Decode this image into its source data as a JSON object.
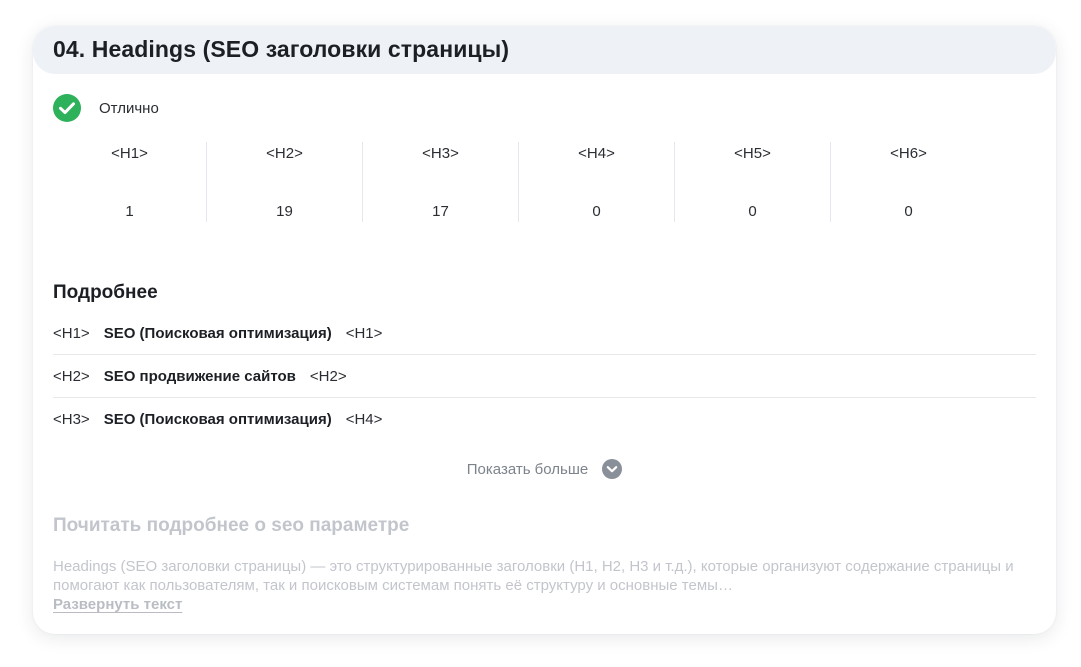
{
  "section": {
    "title": "04. Headings (SEO заголовки страницы)",
    "status": {
      "label": "Отлично",
      "state": "success",
      "color": "#2db15b"
    }
  },
  "headings_summary": [
    {
      "tag": "<H1>",
      "count": "1"
    },
    {
      "tag": "<H2>",
      "count": "19"
    },
    {
      "tag": "<H3>",
      "count": "17"
    },
    {
      "tag": "<H4>",
      "count": "0"
    },
    {
      "tag": "<H5>",
      "count": "0"
    },
    {
      "tag": "<H6>",
      "count": "0"
    }
  ],
  "details": {
    "title": "Подробнее",
    "rows": [
      {
        "open": "<H1>",
        "text": "SEO (Поисковая оптимизация)",
        "close": "<H1>"
      },
      {
        "open": "<H2>",
        "text": "SEO продвижение сайтов",
        "close": "<H2>"
      },
      {
        "open": "<H3>",
        "text": "SEO (Поисковая оптимизация)",
        "close": "<H4>"
      }
    ],
    "show_more_label": "Показать больше",
    "show_more_icon": "chevron-down-circle-icon"
  },
  "read_more": {
    "title": "Почитать подробнее о seo параметре",
    "description": "Headings (SEO заголовки страницы) — это структурированные заголовки (H1, H2, H3 и т.д.), которые организуют содержание страницы и помогают как пользователям, так и поисковым системам понять её структуру и основные темы…",
    "expand_label": "Развернуть текст"
  }
}
